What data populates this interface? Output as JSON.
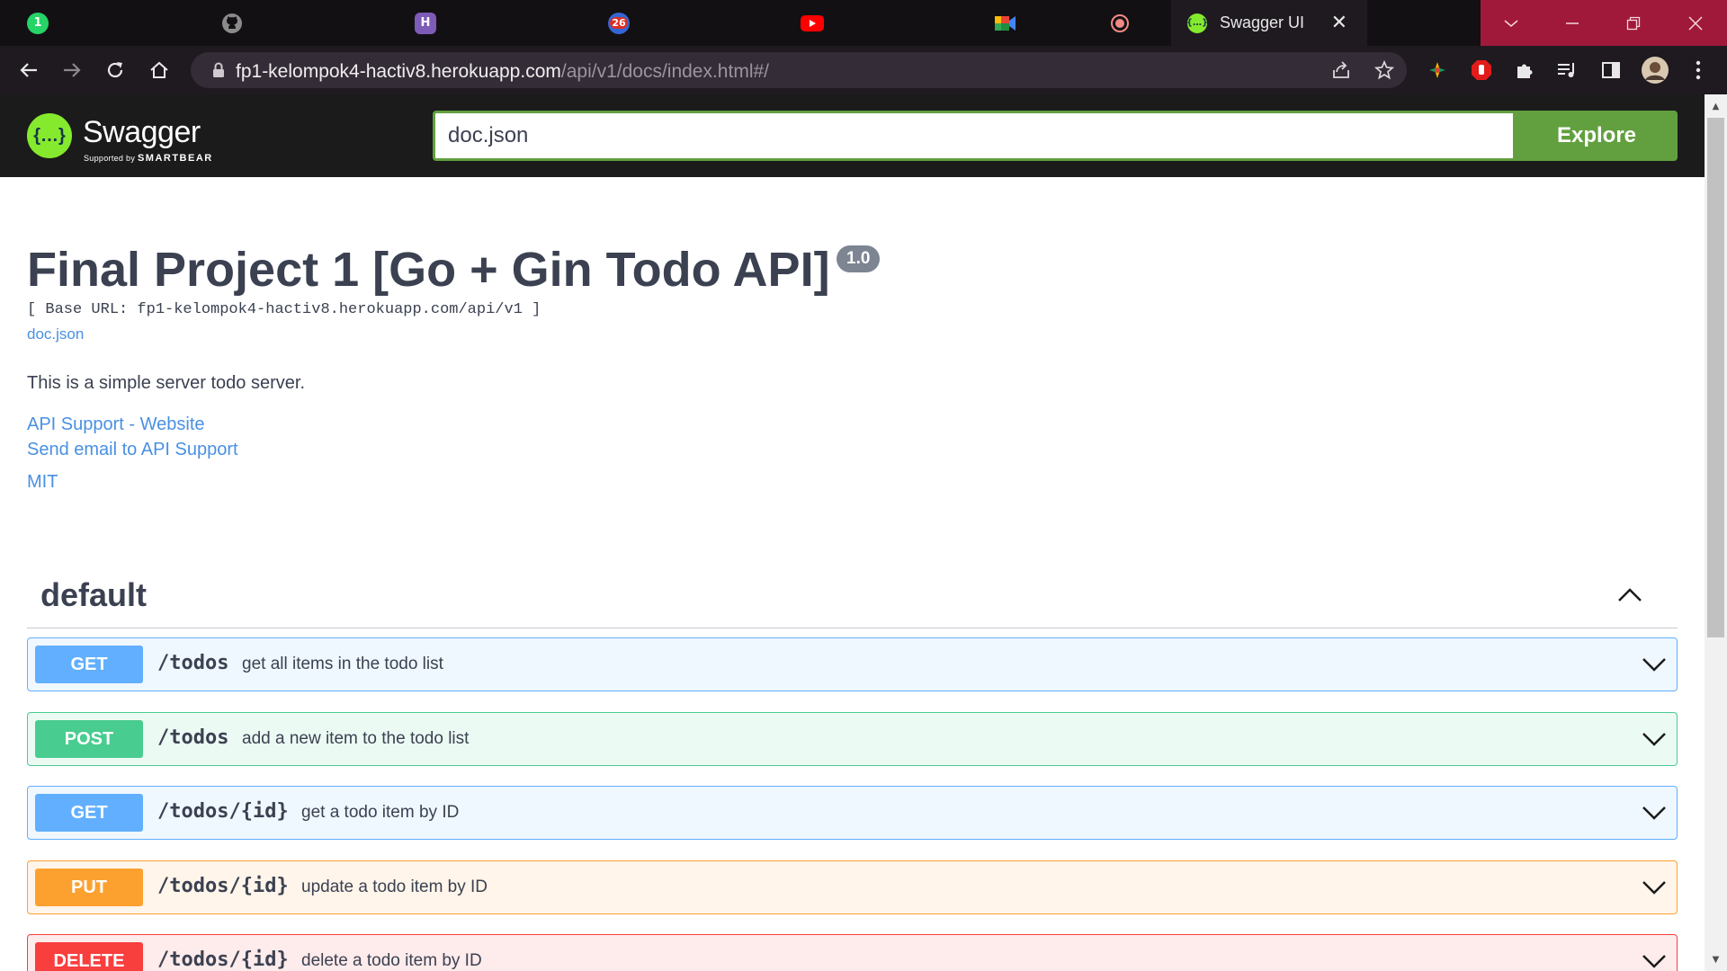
{
  "browser": {
    "tabs": [
      {
        "icon": "whatsapp-icon",
        "badge": "1"
      },
      {
        "icon": "github-icon"
      },
      {
        "icon": "hackerrank-icon",
        "glyph": "H"
      },
      {
        "icon": "chrome-app-icon",
        "badge": "26"
      },
      {
        "icon": "youtube-icon"
      },
      {
        "icon": "google-meet-icon"
      },
      {
        "icon": "record-icon"
      }
    ],
    "active_tab": {
      "title": "Swagger UI",
      "close": "✕"
    },
    "url_host": "fp1-kelompok4-hactiv8.herokuapp.com",
    "url_path": "/api/v1/docs/index.html#/"
  },
  "swagger": {
    "logo_text": "Swagger",
    "logo_sub_prefix": "Supported by",
    "logo_sub_brand": "SMARTBEAR",
    "spec_url": "doc.json",
    "explore_label": "Explore"
  },
  "info": {
    "title": "Final Project 1 [Go + Gin Todo API]",
    "version": "1.0",
    "base_url": "[ Base URL: fp1-kelompok4-hactiv8.herokuapp.com/api/v1 ]",
    "spec_link": "doc.json",
    "description": "This is a simple server todo server.",
    "contact_website": "API Support - Website",
    "contact_email": "Send email to API Support",
    "license": "MIT"
  },
  "tag": {
    "name": "default"
  },
  "operations": [
    {
      "method": "GET",
      "path": "/todos",
      "summary": "get all items in the todo list"
    },
    {
      "method": "POST",
      "path": "/todos",
      "summary": "add a new item to the todo list"
    },
    {
      "method": "GET",
      "path": "/todos/{id}",
      "summary": "get a todo item by ID"
    },
    {
      "method": "PUT",
      "path": "/todos/{id}",
      "summary": "update a todo item by ID"
    },
    {
      "method": "DELETE",
      "path": "/todos/{id}",
      "summary": "delete a todo item by ID"
    }
  ],
  "colors": {
    "get": "#61affe",
    "post": "#49cc90",
    "put": "#fca130",
    "delete": "#f93e3e",
    "swagger_green": "#62a03f",
    "link": "#4990e2"
  }
}
